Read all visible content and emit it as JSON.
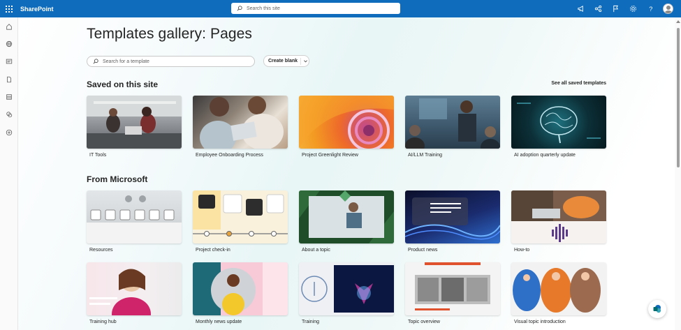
{
  "app": {
    "name": "SharePoint"
  },
  "top_search": {
    "placeholder": "Search this site"
  },
  "page": {
    "title": "Templates gallery: Pages",
    "template_search_placeholder": "Search for a template",
    "create_blank_label": "Create blank"
  },
  "saved": {
    "title": "Saved on this site",
    "see_all": "See all saved templates",
    "cards": [
      {
        "label": "IT Tools"
      },
      {
        "label": "Employee Onboarding Process"
      },
      {
        "label": "Project Greenlight Review"
      },
      {
        "label": "AI/LLM Training"
      },
      {
        "label": "AI adoption quarterly update"
      }
    ]
  },
  "microsoft": {
    "title": "From Microsoft",
    "cards": [
      {
        "label": "Resources"
      },
      {
        "label": "Project check-in"
      },
      {
        "label": "About a topic"
      },
      {
        "label": "Product news"
      },
      {
        "label": "How-to"
      },
      {
        "label": "Training hub"
      },
      {
        "label": "Monthly news update"
      },
      {
        "label": "Training"
      },
      {
        "label": "Topic overview"
      },
      {
        "label": "Visual topic introduction"
      }
    ]
  },
  "colors": {
    "brand": "#0f6cbd",
    "accent_orange": "#e8a23a",
    "accent_green": "#2e7d32"
  }
}
